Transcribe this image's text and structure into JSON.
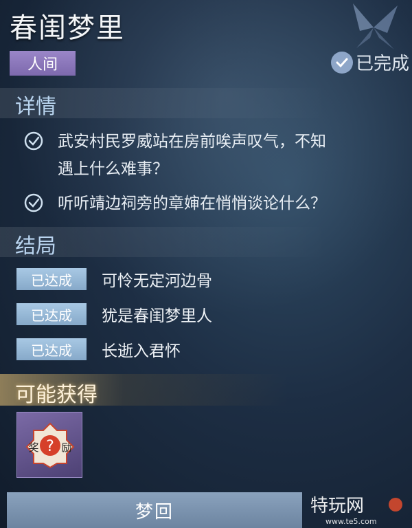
{
  "quest": {
    "title": "春闺梦里",
    "tag": "人间",
    "status": "已完成"
  },
  "details": {
    "heading": "详情",
    "items": [
      {
        "text": "武安村民罗威站在房前唉声叹气，不知\n遇上什么难事？",
        "checked": true
      },
      {
        "text": "听听靖边祠旁的章婶在悄悄谈论什么？",
        "checked": true
      }
    ]
  },
  "endings": {
    "heading": "结局",
    "items": [
      {
        "badge": "已达成",
        "text": "可怜无定河边骨"
      },
      {
        "badge": "已达成",
        "text": "犹是春闺梦里人"
      },
      {
        "badge": "已达成",
        "text": "长逝入君怀"
      }
    ]
  },
  "rewards": {
    "heading": "可能获得",
    "items": [
      {
        "icon": "reward-icon",
        "text": "奖励"
      }
    ]
  },
  "actions": {
    "primary": "梦回"
  },
  "watermark": {
    "brand": "特玩网",
    "url": "www.te5.com"
  },
  "colors": {
    "tag": "#8b77bb",
    "badge": "#97b8d6",
    "section_heading": "#b9d4ef",
    "reward_highlight": "#f0c878"
  }
}
